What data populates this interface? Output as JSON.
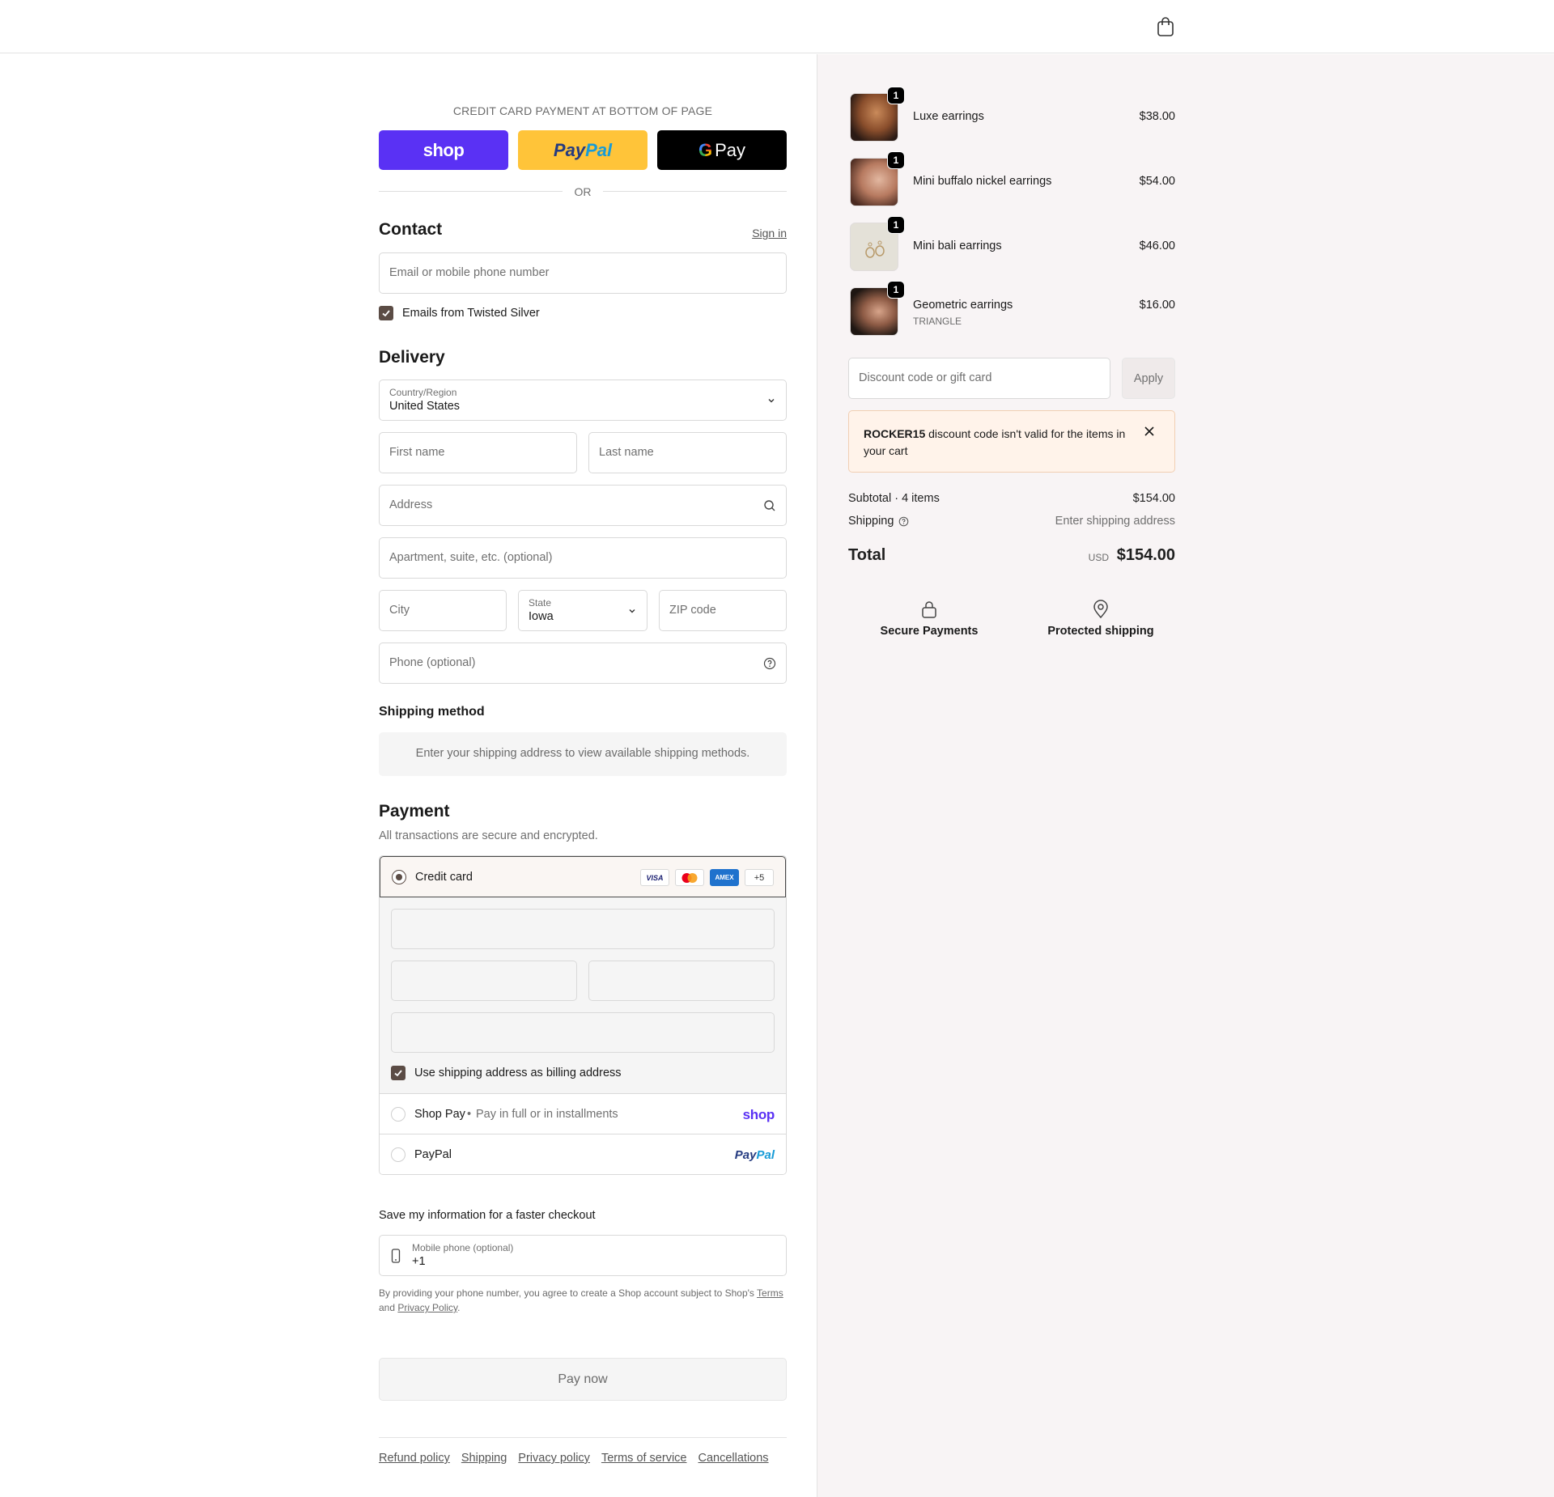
{
  "header": {
    "cart_icon": "shopping-bag-icon"
  },
  "express": {
    "title": "CREDIT CARD PAYMENT AT BOTTOM OF PAGE",
    "shop_label": "shop",
    "paypal_label_a": "Pay",
    "paypal_label_b": "Pal",
    "gpay_g": "G",
    "gpay_label": "Pay",
    "or": "OR"
  },
  "contact": {
    "title": "Contact",
    "sign_in": "Sign in",
    "email_placeholder": "Email or mobile phone number",
    "newsletter_label": "Emails from Twisted Silver",
    "newsletter_checked": true
  },
  "delivery": {
    "title": "Delivery",
    "country_label": "Country/Region",
    "country_value": "United States",
    "first_name": "First name",
    "last_name": "Last name",
    "address": "Address",
    "apartment": "Apartment, suite, etc. (optional)",
    "city": "City",
    "state_label": "State",
    "state_value": "Iowa",
    "zip": "ZIP code",
    "phone": "Phone (optional)"
  },
  "shipping_method": {
    "title": "Shipping method",
    "message": "Enter your shipping address to view available shipping methods."
  },
  "payment": {
    "title": "Payment",
    "subtitle": "All transactions are secure and encrypted.",
    "credit_card_label": "Credit card",
    "card_badges": [
      "VISA",
      "",
      "AMEX",
      "+5"
    ],
    "billing_same_label": "Use shipping address as billing address",
    "shop_pay_label": "Shop Pay",
    "shop_pay_sub": "Pay in full or in installments",
    "shop_pay_logo": "shop",
    "paypal_label": "PayPal",
    "paypal_logo_a": "Pay",
    "paypal_logo_b": "Pal"
  },
  "save_info": {
    "title": "Save my information for a faster checkout",
    "mobile_label": "Mobile phone (optional)",
    "mobile_value": "+1",
    "legal_prefix": "By providing your phone number, you agree to create a Shop account subject to Shop's",
    "terms": "Terms",
    "and": "and",
    "privacy": "Privacy Policy",
    "period": "."
  },
  "pay_now": "Pay now",
  "footer": [
    "Refund policy",
    "Shipping",
    "Privacy policy",
    "Terms of service",
    "Cancellations"
  ],
  "summary": {
    "items": [
      {
        "name": "Luxe earrings",
        "variant": "",
        "price": "$38.00",
        "qty": "1"
      },
      {
        "name": "Mini buffalo nickel earrings",
        "variant": "",
        "price": "$54.00",
        "qty": "1"
      },
      {
        "name": "Mini bali earrings",
        "variant": "",
        "price": "$46.00",
        "qty": "1"
      },
      {
        "name": "Geometric earrings",
        "variant": "TRIANGLE",
        "price": "$16.00",
        "qty": "1"
      }
    ],
    "discount_placeholder": "Discount code or gift card",
    "apply": "Apply",
    "alert_code": "ROCKER15",
    "alert_text": " discount code isn't valid for the items in your cart",
    "subtotal_label": "Subtotal · 4 items",
    "subtotal_value": "$154.00",
    "shipping_label": "Shipping",
    "shipping_value": "Enter shipping address",
    "total_label": "Total",
    "total_currency": "USD",
    "total_value": "$154.00",
    "trust": [
      "Secure Payments",
      "Protected shipping"
    ]
  },
  "colors": {
    "shop_purple": "#5a31f4",
    "paypal_yellow": "#ffc439",
    "accent_brown": "#5b4c45",
    "panel_bg": "#f8f4f5"
  }
}
